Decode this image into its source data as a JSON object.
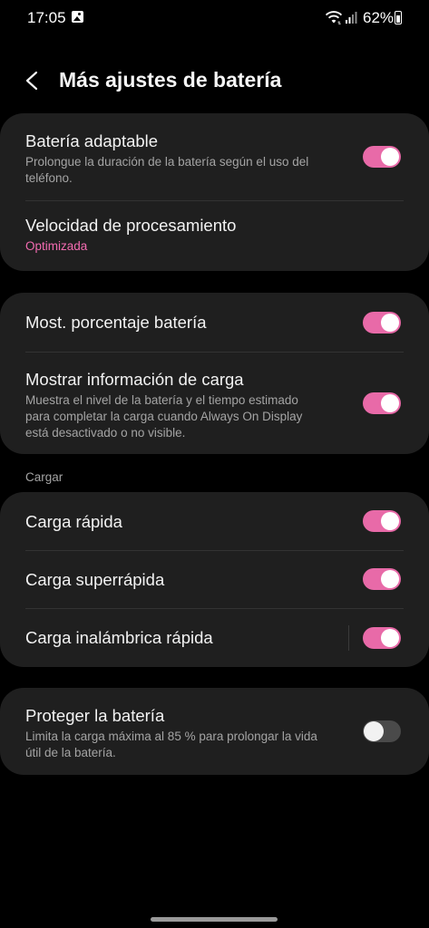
{
  "status_bar": {
    "time": "17:05",
    "battery_percent": "62%",
    "icons": [
      "gallery-icon",
      "wifi-icon",
      "signal-icon",
      "battery-icon"
    ]
  },
  "header": {
    "title": "Más ajustes de batería",
    "back_icon": "chevron-left-icon"
  },
  "colors": {
    "accent": "#e86aa8",
    "background": "#000000",
    "card": "#1f1f1f"
  },
  "group1": {
    "adaptive_battery": {
      "title": "Batería adaptable",
      "description": "Prolongue la duración de la batería según el uso del teléfono.",
      "enabled": true
    },
    "processing_speed": {
      "title": "Velocidad de procesamiento",
      "value": "Optimizada"
    }
  },
  "group2": {
    "show_percentage": {
      "title": "Most. porcentaje batería",
      "enabled": true
    },
    "charging_info": {
      "title": "Mostrar información de carga",
      "description": "Muestra el nivel de la batería y el tiempo estimado para completar la carga cuando Always On Display está desactivado o no visible.",
      "enabled": true
    }
  },
  "charging_section": {
    "label": "Cargar",
    "fast_charging": {
      "title": "Carga rápida",
      "enabled": true
    },
    "super_fast_charging": {
      "title": "Carga superrápida",
      "enabled": true
    },
    "fast_wireless_charging": {
      "title": "Carga inalámbrica rápida",
      "enabled": true
    }
  },
  "protect_battery": {
    "title": "Proteger la batería",
    "description": "Limita la carga máxima al 85 % para prolongar la vida útil de la batería.",
    "enabled": false
  }
}
